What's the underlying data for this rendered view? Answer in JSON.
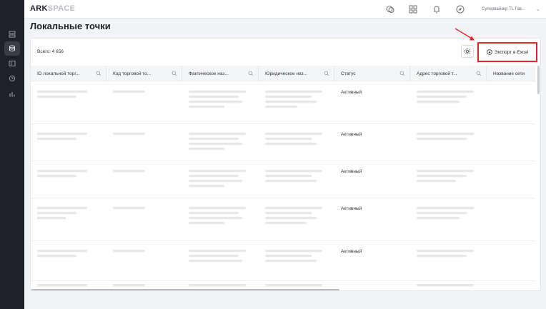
{
  "app": {
    "logo_part1": "ARK",
    "logo_part2": "SPACE",
    "user_name": "Супервайзер TL Гав..."
  },
  "page": {
    "title": "Локальные точки",
    "total_label": "Всего: 4 656",
    "export_label": "Экспорт в Excel"
  },
  "table": {
    "columns": [
      {
        "label": "ID локальной торг..."
      },
      {
        "label": "Код торговой то..."
      },
      {
        "label": "Фактическое наз..."
      },
      {
        "label": "Юридическое наз..."
      },
      {
        "label": "Статус"
      },
      {
        "label": "Адрес торговой т..."
      },
      {
        "label": "Название сети"
      }
    ],
    "rows": [
      {
        "status": "Активный"
      },
      {
        "status": "Активный"
      },
      {
        "status": "Активный"
      },
      {
        "status": "Активный"
      },
      {
        "status": "Активный"
      },
      {
        "status": ""
      }
    ]
  },
  "colors": {
    "sidebar_bg": "#1f2126",
    "highlight_red": "#e4262a"
  },
  "icons": [
    "database-icon",
    "layers-icon",
    "panel-icon",
    "clock-icon",
    "chart-icon",
    "currency-icon",
    "grid-icon",
    "bell-icon",
    "compass-icon",
    "search-icon",
    "gear-icon",
    "download-icon",
    "chevron-down-icon"
  ]
}
